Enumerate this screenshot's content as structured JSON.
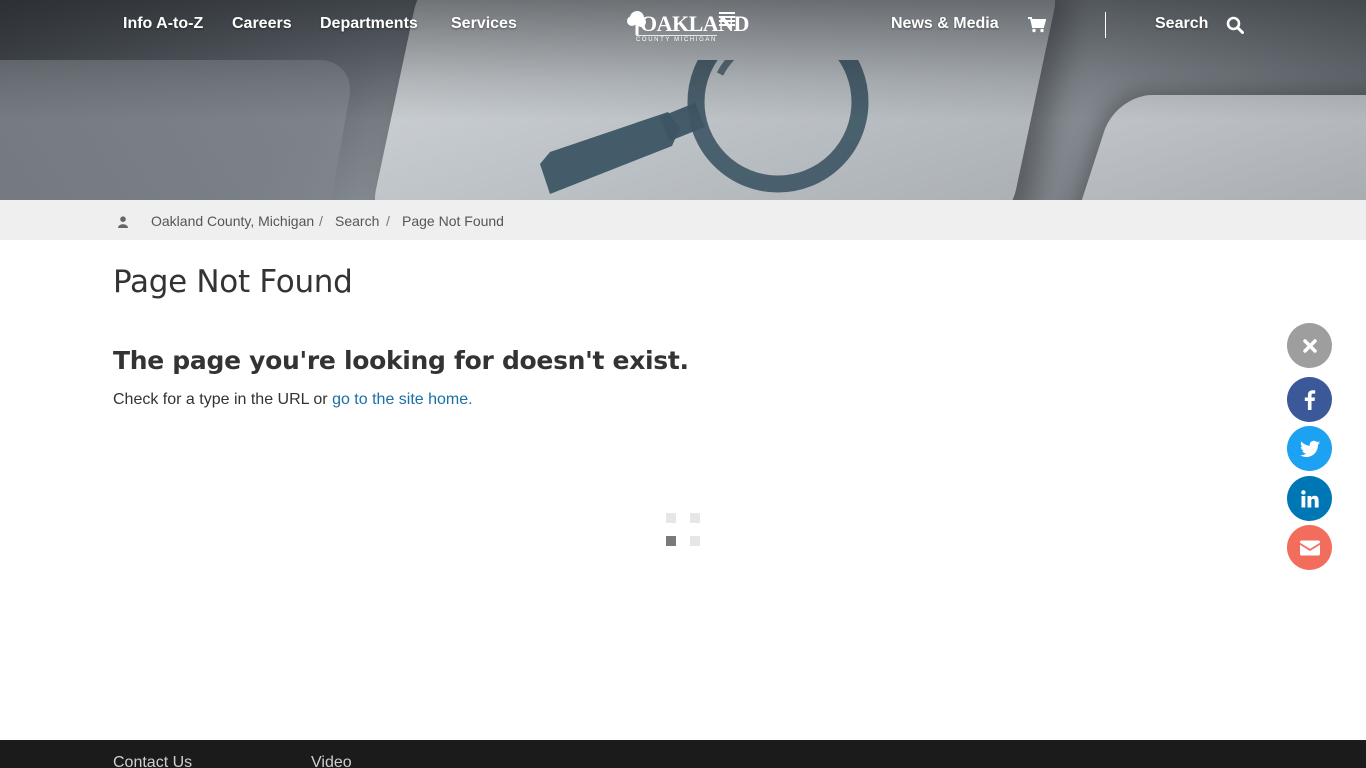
{
  "colors": {
    "link": "#1a6fa6",
    "breadcrumb_bg": "#efefef",
    "footer_bg": "#1b1b1b",
    "share_close": "#9e9e9e",
    "share_facebook": "#3b5998",
    "share_twitter": "#1da1f2",
    "share_linkedin": "#0077b5",
    "share_email": "#f26d5b"
  },
  "nav": {
    "left_items": [
      {
        "label": "Info A-to-Z"
      },
      {
        "label": "Careers"
      },
      {
        "label": "Departments"
      },
      {
        "label": "Services"
      }
    ],
    "logo": {
      "name": "OAKLAND",
      "subtitle": "COUNTY MICHIGAN"
    },
    "news_media": "News & Media",
    "cart_icon": "shopping-cart-icon",
    "search_label": "Search",
    "search_icon": "magnifying-glass-icon"
  },
  "breadcrumb": {
    "home_icon": "user-icon",
    "items": [
      "Oakland County, Michigan",
      "Search",
      "Page Not Found"
    ],
    "separator": "/"
  },
  "main": {
    "title": "Page Not Found",
    "subtitle": "The page you're looking for doesn't exist.",
    "body_prefix": "Check for a type in the URL or ",
    "home_link": "go to the site home."
  },
  "share_bar": {
    "icons": [
      "close-icon",
      "facebook-icon",
      "twitter-icon",
      "linkedin-icon",
      "email-icon"
    ]
  },
  "footer": {
    "links": [
      "Contact Us",
      "Video"
    ]
  }
}
